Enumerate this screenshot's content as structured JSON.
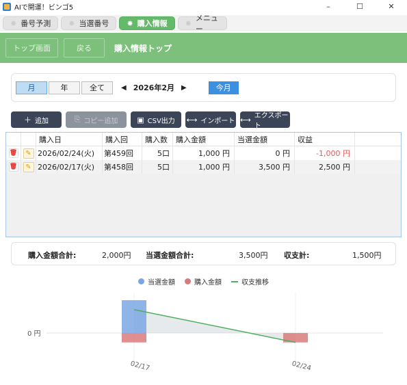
{
  "window": {
    "title": "AIで開運！ビンゴ5",
    "controls": [
      "–",
      "☐",
      "✕"
    ]
  },
  "tabs": [
    {
      "label": "番号予測",
      "active": false
    },
    {
      "label": "当選番号",
      "active": false
    },
    {
      "label": "購入情報",
      "active": true
    },
    {
      "label": "メニュー",
      "active": false
    }
  ],
  "header": {
    "top_button": "トップ画面",
    "back_button": "戻る",
    "title": "購入情報トップ"
  },
  "period": {
    "segments": [
      "月",
      "年",
      "全て"
    ],
    "active_segment": "月",
    "prev": "◀",
    "next": "▶",
    "current": "2026年2月",
    "today": "今月"
  },
  "actions": [
    {
      "icon": "plus-icon",
      "glyph": "＋",
      "label": "追加",
      "disabled": false
    },
    {
      "icon": "copy-icon",
      "glyph": "⎘",
      "label": "コピー追加",
      "disabled": true
    },
    {
      "icon": "save-icon",
      "glyph": "▣",
      "label": "CSV出力",
      "disabled": false
    },
    {
      "icon": "import-icon",
      "glyph": "⟷",
      "label": "インポート",
      "disabled": false
    },
    {
      "icon": "export-icon",
      "glyph": "⟷",
      "label": "エクスポート",
      "disabled": false
    }
  ],
  "table": {
    "columns": [
      "購入日",
      "購入回",
      "購入数",
      "購入金額",
      "当選金額",
      "収益"
    ],
    "rows": [
      {
        "date": "2026/02/24(火)",
        "round": "第459回",
        "count": "5口",
        "purchase": "1,000 円",
        "win": "0 円",
        "profit": "-1,000 円",
        "negative": true
      },
      {
        "date": "2026/02/17(火)",
        "round": "第458回",
        "count": "5口",
        "purchase": "1,000 円",
        "win": "3,500 円",
        "profit": "2,500 円",
        "negative": false
      }
    ]
  },
  "totals": {
    "purchase_label": "購入金額合計:",
    "purchase_value": "2,000円",
    "win_label": "当選金額合計:",
    "win_value": "3,500円",
    "balance_label": "収支計:",
    "balance_value": "1,500円"
  },
  "chart_data": {
    "type": "bar",
    "categories": [
      "02/17",
      "02/24"
    ],
    "series": [
      {
        "name": "当選金額",
        "values": [
          3500,
          0
        ],
        "color": "#7ba7e3"
      },
      {
        "name": "購入金額",
        "values": [
          -1000,
          -1000
        ],
        "color": "#d97b7b"
      },
      {
        "name": "収支推移",
        "values": [
          2500,
          -1000
        ],
        "color": "#4fae5e",
        "kind": "line"
      }
    ],
    "ylabel_tick": "0 円",
    "legend_position": "top"
  }
}
